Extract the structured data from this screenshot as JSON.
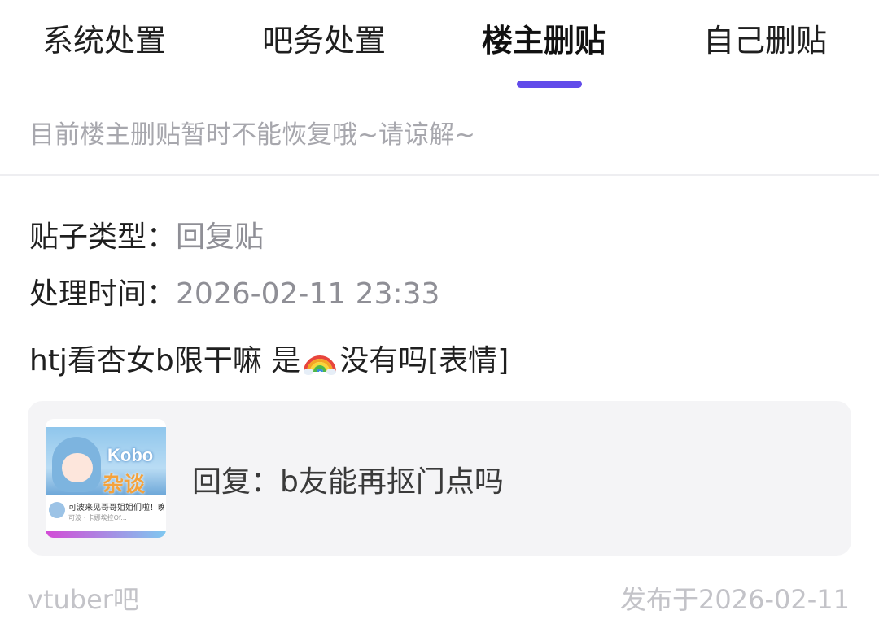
{
  "tabs": [
    {
      "label": "系统处置"
    },
    {
      "label": "吧务处置"
    },
    {
      "label": "楼主删贴"
    },
    {
      "label": "自己删贴"
    }
  ],
  "active_tab_index": 2,
  "accent_color": "#614bea",
  "notice": "目前楼主删贴暂时不能恢复哦~请谅解~",
  "post": {
    "type_label": "贴子类型：",
    "type_value": "回复贴",
    "time_label": "处理时间：",
    "time_value": "2026-02-11 23:33",
    "content_before_emoji": "htj看杏女b限干嘛 是",
    "emoji": "rainbow-icon",
    "content_after_emoji": "没有吗[表情]",
    "quote": {
      "thumbnail_title": "Kobo",
      "thumbnail_subtitle": "杂谈",
      "thumbnail_caption": "可波来见哥哥姐姐们啦！晚",
      "thumbnail_meta": "可波 · 卡娜埃拉Of...",
      "text": "回复：b友能再抠门点吗"
    },
    "forum": "vtuber吧",
    "published": "发布于2026-02-11"
  }
}
